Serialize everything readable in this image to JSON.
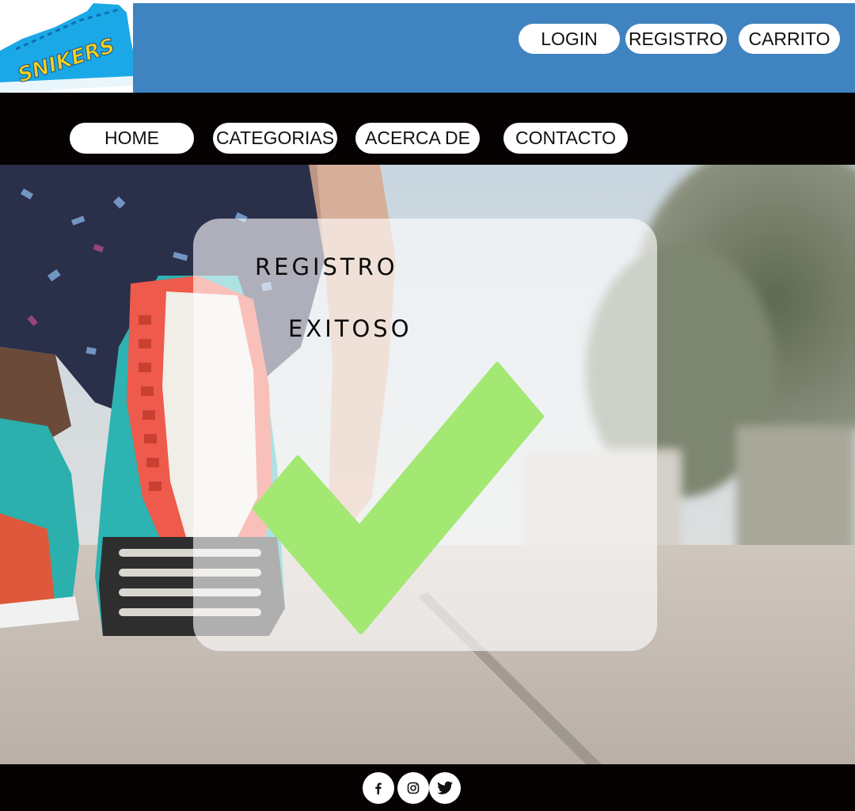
{
  "header": {
    "logo_text": "SNIKERS",
    "buttons": {
      "login": "LOGIN",
      "registro": "REGISTRO",
      "carrito": "CARRITO"
    }
  },
  "nav": {
    "home": "HOME",
    "categorias": "CATEGORIAS",
    "acerca": "ACERCA DE",
    "contacto": "CONTACTO"
  },
  "card": {
    "line1": "REGISTRO",
    "line2": "EXITOSO",
    "check_icon": "checkmark-icon"
  },
  "footer": {
    "social": [
      "facebook-icon",
      "instagram-icon",
      "twitter-icon"
    ]
  },
  "colors": {
    "header_bg": "#3f84c0",
    "bar_bg": "#060202",
    "check": "#a3e872"
  }
}
